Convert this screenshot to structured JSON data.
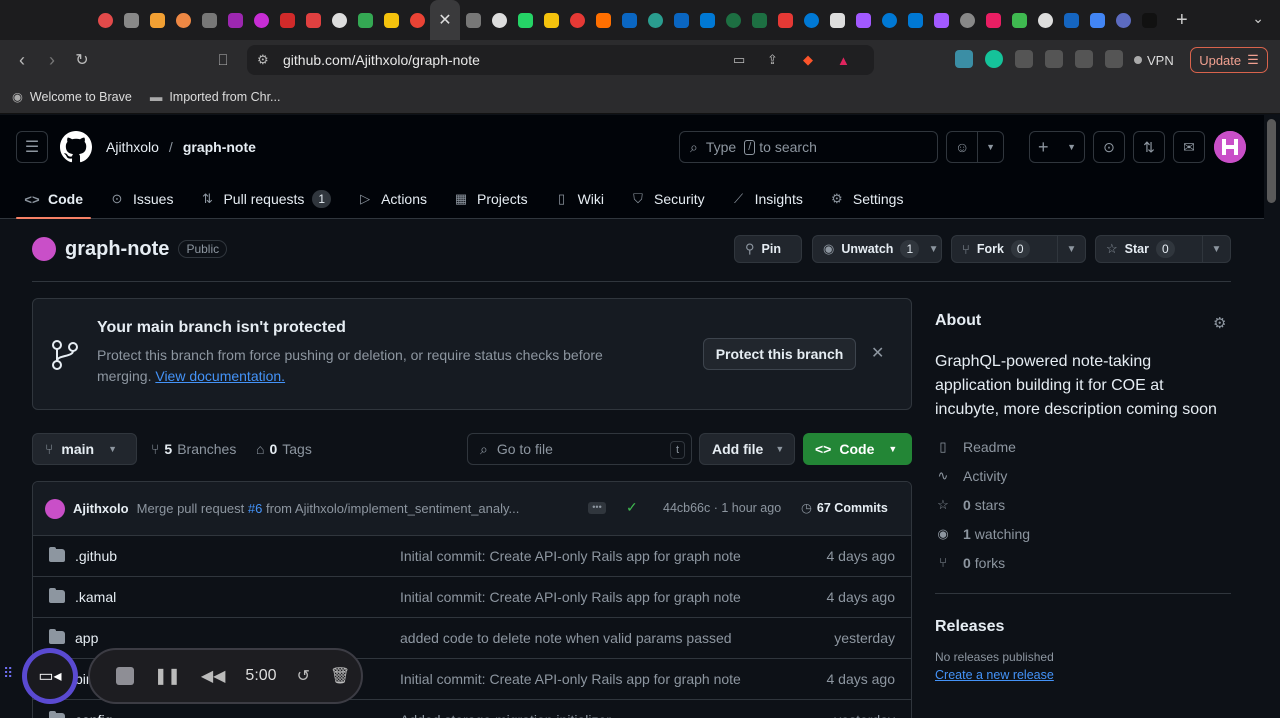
{
  "browser": {
    "url": "github.com/Ajithxolo/graph-note",
    "vpn_label": "VPN",
    "update_label": "Update",
    "bookmarks": [
      "Welcome to Brave",
      "Imported from Chr..."
    ],
    "tab_colors": [
      "#e24a4a",
      "#888888",
      "#f2a033",
      "#ee8844",
      "#777777",
      "#9c27b0",
      "#c72dd4",
      "#d12a2a",
      "#e04040",
      "#dddddd",
      "#34a853",
      "#f4c20d",
      "#ea4335",
      "#3a3a3c",
      "#777777",
      "#dddddd",
      "#25d366",
      "#f4c20d",
      "#e53935",
      "#ff6f00",
      "#0a66c2",
      "#2a9d8f",
      "#0a66c2",
      "#0078d4",
      "#1d6f42",
      "#1d6f42",
      "#e53935",
      "#0078d4",
      "#dddddd",
      "#a259ff",
      "#0078d4",
      "#0078d4",
      "#a259ff",
      "#888888",
      "#e91e63",
      "#3fb950",
      "#dddddd",
      "#1565c0",
      "#4285f4",
      "#5c6bc0",
      "#111111"
    ]
  },
  "header": {
    "owner": "Ajithxolo",
    "separator": "/",
    "repo": "graph-note",
    "search_prefix": "Type",
    "search_key": "/",
    "search_suffix": "to search"
  },
  "repo_nav": [
    {
      "label": "Code",
      "icon": "code-icon",
      "glyph": "<>",
      "active": true
    },
    {
      "label": "Issues",
      "icon": "issue-icon",
      "glyph": "⊙"
    },
    {
      "label": "Pull requests",
      "icon": "pull-request-icon",
      "glyph": "⇅",
      "count": "1"
    },
    {
      "label": "Actions",
      "icon": "play-icon",
      "glyph": "▷"
    },
    {
      "label": "Projects",
      "icon": "table-icon",
      "glyph": "▦"
    },
    {
      "label": "Wiki",
      "icon": "book-icon",
      "glyph": "▯"
    },
    {
      "label": "Security",
      "icon": "shield-icon",
      "glyph": "⛉"
    },
    {
      "label": "Insights",
      "icon": "graph-icon",
      "glyph": "⟋"
    },
    {
      "label": "Settings",
      "icon": "gear-icon",
      "glyph": "⚙"
    }
  ],
  "repo": {
    "name": "graph-note",
    "visibility": "Public",
    "pin": "Pin",
    "unwatch": "Unwatch",
    "watch_count": "1",
    "fork": "Fork",
    "fork_count": "0",
    "star": "Star",
    "star_count": "0"
  },
  "banner": {
    "title": "Your main branch isn't protected",
    "desc": "Protect this branch from force pushing or deletion, or require status checks before merging.",
    "link": "View documentation.",
    "button": "Protect this branch"
  },
  "branch_bar": {
    "branch": "main",
    "branches_count": "5",
    "branches_label": "Branches",
    "tags_count": "0",
    "tags_label": "Tags",
    "goto_placeholder": "Go to file",
    "goto_key": "t",
    "add_file": "Add file",
    "code": "Code"
  },
  "commit": {
    "author": "Ajithxolo",
    "msg_prefix": "Merge pull request",
    "pr": "#6",
    "msg_suffix": "from Ajithxolo/implement_sentiment_analy...",
    "sha_time": "44cb66c · 1 hour ago",
    "commits": "67 Commits"
  },
  "files": [
    {
      "name": ".github",
      "msg": "Initial commit: Create API-only Rails app for graph note",
      "date": "4 days ago"
    },
    {
      "name": ".kamal",
      "msg": "Initial commit: Create API-only Rails app for graph note",
      "date": "4 days ago"
    },
    {
      "name": "app",
      "msg": "added code to delete note when valid params passed",
      "date": "yesterday"
    },
    {
      "name": "bin",
      "msg": "Initial commit: Create API-only Rails app for graph note",
      "date": "4 days ago"
    },
    {
      "name": "config",
      "msg": "Added storage migration initializer",
      "date": "yesterday"
    }
  ],
  "about": {
    "title": "About",
    "description": "GraphQL-powered note-taking application building it for COE at incubyte, more description coming soon",
    "readme": "Readme",
    "activity": "Activity",
    "stars_count": "0",
    "stars": "stars",
    "watching_count": "1",
    "watching": "watching",
    "forks_count": "0",
    "forks": "forks",
    "releases_title": "Releases",
    "no_releases": "No releases published",
    "create_release": "Create a new release"
  },
  "recorder": {
    "time": "5:00"
  }
}
